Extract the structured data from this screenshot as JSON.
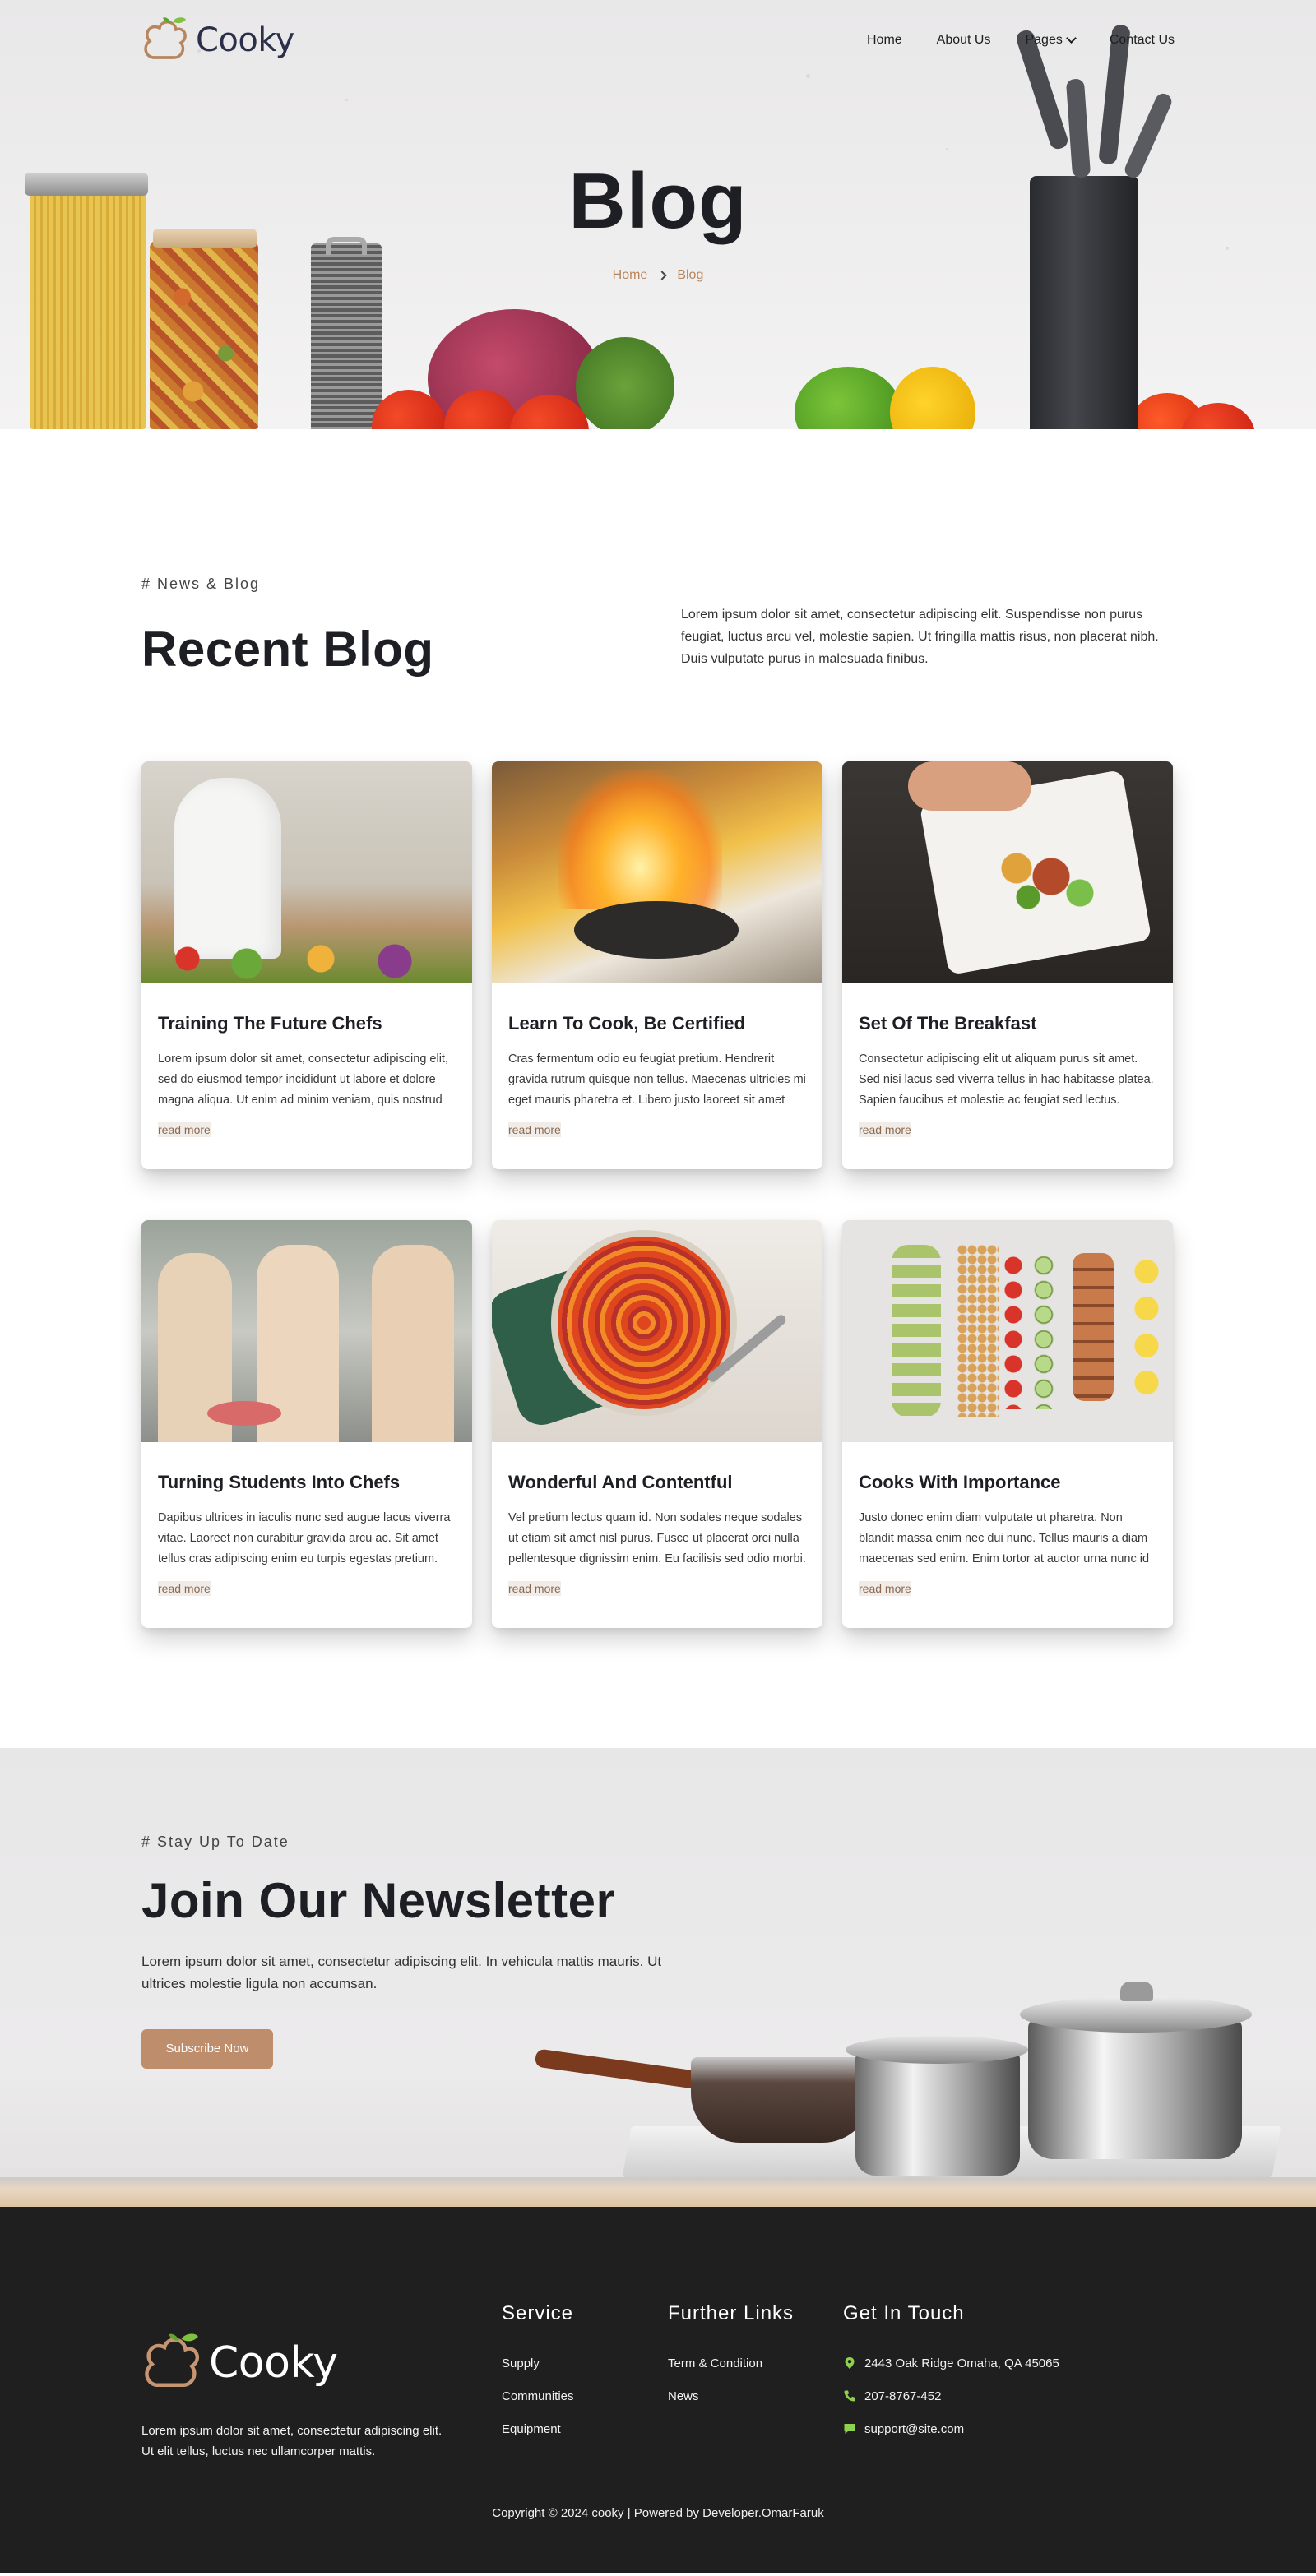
{
  "brand": {
    "name": "Cooky"
  },
  "nav": {
    "items": [
      {
        "label": "Home"
      },
      {
        "label": "About Us"
      },
      {
        "label": "Pages"
      },
      {
        "label": "Contact Us"
      }
    ]
  },
  "hero": {
    "title": "Blog",
    "breadcrumb": {
      "home": "Home",
      "current": "Blog"
    }
  },
  "blog": {
    "eyebrow": "# News & Blog",
    "title": "Recent Blog",
    "description": "Lorem ipsum dolor sit amet, consectetur adipiscing elit. Suspendisse non purus feugiat, luctus arcu vel, molestie sapien. Ut fringilla mattis risus, non placerat nibh. Duis vulputate purus in malesuada finibus.",
    "read_more": "read more",
    "cards": [
      {
        "title": "Training The Future Chefs",
        "text": "Lorem ipsum dolor sit amet, consectetur adipiscing elit, sed do eiusmod tempor incididunt ut labore et dolore magna aliqua. Ut enim ad minim veniam, quis nostrud exercitation."
      },
      {
        "title": "Learn To Cook, Be Certified",
        "text": "Cras fermentum odio eu feugiat pretium. Hendrerit gravida rutrum quisque non tellus. Maecenas ultricies mi eget mauris pharetra et. Libero justo laoreet sit amet cursus."
      },
      {
        "title": "Set Of The Breakfast",
        "text": "Consectetur adipiscing elit ut aliquam purus sit amet. Sed nisi lacus sed viverra tellus in hac habitasse platea. Sapien faucibus et molestie ac feugiat sed lectus."
      },
      {
        "title": "Turning Students Into Chefs",
        "text": "Dapibus ultrices in iaculis nunc sed augue lacus viverra vitae. Laoreet non curabitur gravida arcu ac. Sit amet tellus cras adipiscing enim eu turpis egestas pretium."
      },
      {
        "title": "Wonderful And Contentful",
        "text": "Vel pretium lectus quam id. Non sodales neque sodales ut etiam sit amet nisl purus. Fusce ut placerat orci nulla pellentesque dignissim enim. Eu facilisis sed odio morbi."
      },
      {
        "title": "Cooks With Importance",
        "text": "Justo donec enim diam vulputate ut pharetra. Non blandit massa enim nec dui nunc. Tellus mauris a diam maecenas sed enim. Enim tortor at auctor urna nunc id cursus."
      }
    ]
  },
  "newsletter": {
    "eyebrow": "# Stay Up To Date",
    "title": "Join Our Newsletter",
    "text": "Lorem ipsum dolor sit amet, consectetur adipiscing elit. In vehicula mattis mauris. Ut ultrices molestie ligula non accumsan.",
    "button": "Subscribe Now"
  },
  "footer": {
    "about": "Lorem ipsum dolor sit amet, consectetur adipiscing elit. Ut elit tellus, luctus nec ullamcorper mattis.",
    "service": {
      "title": "Service",
      "items": [
        "Supply",
        "Communities",
        "Equipment"
      ]
    },
    "links": {
      "title": "Further Links",
      "items": [
        "Term & Condition",
        "News"
      ]
    },
    "contact": {
      "title": "Get In Touch",
      "address": "2443 Oak Ridge Omaha, QA 45065",
      "phone": "207-8767-452",
      "email": "support@site.com"
    },
    "copyright": "Copyright © 2024 cooky | Powered by Developer.OmarFaruk"
  },
  "colors": {
    "accent": "#be8d6c",
    "breadcrumb": "#b8865e",
    "dark": "#1f1f1f",
    "heading": "#1e1f24",
    "icon_green": "#8fd14f"
  },
  "icons": [
    "chef-hat-logo-icon",
    "chevron-down-icon",
    "chevron-right-icon",
    "location-pin-icon",
    "phone-icon",
    "message-icon"
  ]
}
